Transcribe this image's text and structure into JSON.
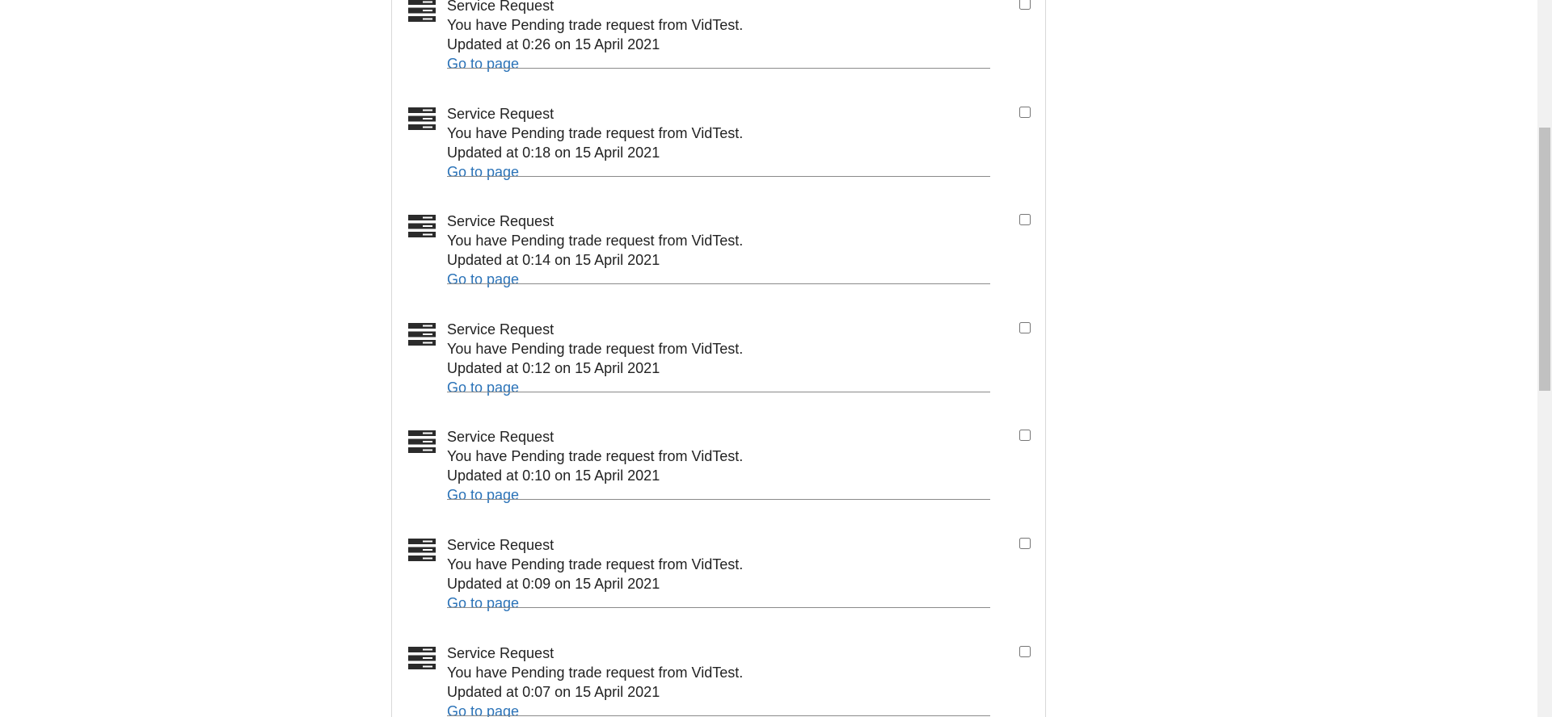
{
  "notifications": {
    "items": [
      {
        "title": "Service Request",
        "message": "You have Pending trade request from VidTest.",
        "updated": "Updated at 0:26 on 15 April 2021",
        "link_label": "Go to page",
        "checked": false
      },
      {
        "title": "Service Request",
        "message": "You have Pending trade request from VidTest.",
        "updated": "Updated at 0:18 on 15 April 2021",
        "link_label": "Go to page",
        "checked": false
      },
      {
        "title": "Service Request",
        "message": "You have Pending trade request from VidTest.",
        "updated": "Updated at 0:14 on 15 April 2021",
        "link_label": "Go to page",
        "checked": false
      },
      {
        "title": "Service Request",
        "message": "You have Pending trade request from VidTest.",
        "updated": "Updated at 0:12 on 15 April 2021",
        "link_label": "Go to page",
        "checked": false
      },
      {
        "title": "Service Request",
        "message": "You have Pending trade request from VidTest.",
        "updated": "Updated at 0:10 on 15 April 2021",
        "link_label": "Go to page",
        "checked": false
      },
      {
        "title": "Service Request",
        "message": "You have Pending trade request from VidTest.",
        "updated": "Updated at 0:09 on 15 April 2021",
        "link_label": "Go to page",
        "checked": false
      },
      {
        "title": "Service Request",
        "message": "You have Pending trade request from VidTest.",
        "updated": "Updated at 0:07 on 15 April 2021",
        "link_label": "Go to page",
        "checked": false
      }
    ]
  },
  "icons": {
    "item_icon": "server-stack-icon"
  },
  "colors": {
    "link": "#2b73b8",
    "text": "#222222",
    "divider": "#8a8a8a",
    "panel_border": "#d9d9d9"
  }
}
